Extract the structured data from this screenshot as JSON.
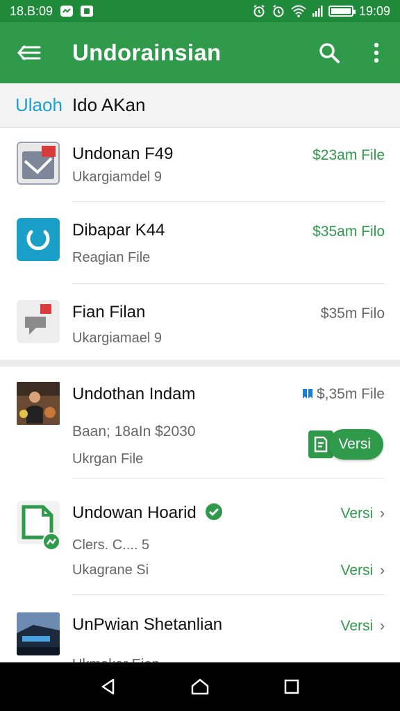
{
  "status_bar": {
    "time_left": "18.B:09",
    "time_right": "19:09"
  },
  "app_bar": {
    "title": "Undorainsian",
    "menu_icon": "menu-icon",
    "search_icon": "search-icon",
    "more_icon": "more-vert-icon",
    "color": "#2e9a4a"
  },
  "sub_header": {
    "link": "Ulaoh",
    "text": "Ido AKan"
  },
  "items": [
    {
      "title": "Undonan F49",
      "subtitle": "Ukargiamdel 9",
      "meta": "$23am File"
    },
    {
      "title": "Dibapar K44",
      "subtitle": "Reagian File",
      "meta": "$35am Filo"
    },
    {
      "title": "Fian Filan",
      "subtitle": "Ukargiamael 9",
      "meta": "$35m Filo"
    },
    {
      "title": "Undothan Indam",
      "subtitle_green": "Baan; 18aIn $2030",
      "subtitle": "Ukrgan File",
      "meta": "$,35m File",
      "button": "Versi"
    },
    {
      "title": "Undowan Hoarid",
      "subtitle": "Clers. C.... 5",
      "subtitle2": "Ukagrane Si",
      "meta": "Versi",
      "meta2": "Versi"
    },
    {
      "title": "UnPwian Shetanlian",
      "subtitle": "Ukmakar Eien",
      "meta": "Versi"
    }
  ],
  "nav": {
    "back_icon": "back-icon",
    "home_icon": "home-icon",
    "recents_icon": "recents-icon"
  }
}
